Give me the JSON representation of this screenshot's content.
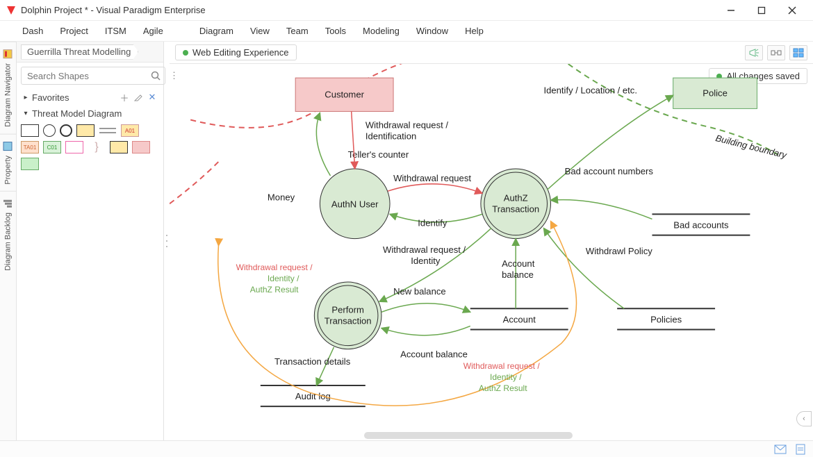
{
  "window": {
    "title": "Dolphin Project * - Visual Paradigm Enterprise"
  },
  "menu": {
    "items": [
      "Dash",
      "Project",
      "ITSM",
      "Agile",
      "Diagram",
      "View",
      "Team",
      "Tools",
      "Modeling",
      "Window",
      "Help"
    ]
  },
  "side_tabs": [
    "Diagram Navigator",
    "Property",
    "Diagram Backlog"
  ],
  "breadcrumb": {
    "item": "Guerrilla Threat Modelling"
  },
  "search": {
    "placeholder": "Search Shapes"
  },
  "favorites": {
    "label": "Favorites"
  },
  "section": {
    "label": "Threat Model Diagram"
  },
  "palette_labels": {
    "a01": "A01",
    "ta01": "TA01",
    "c01": "C01"
  },
  "doc": {
    "tab": "Web Editing Experience",
    "save_state": "All changes saved"
  },
  "diagram": {
    "customer": "Customer",
    "police": "Police",
    "authn": "AuthN User",
    "authz_l1": "AuthZ",
    "authz_l2": "Transaction",
    "perform_l1": "Perform",
    "perform_l2": "Transaction",
    "building_boundary": "Building boundary",
    "labels": {
      "identify_loc": "Identify / Location / etc.",
      "withdraw_req_id_l1": "Withdrawal request /",
      "withdraw_req_id_l2": "Identification",
      "tellers_counter": "Teller's counter",
      "withdrawal_request": "Withdrawal request",
      "identify": "Identify",
      "money": "Money",
      "bad_account_numbers": "Bad account numbers",
      "bad_accounts": "Bad accounts",
      "withdraw_policy": "Withdrawl Policy",
      "policies": "Policies",
      "withdraw_req_identity_l1": "Withdrawal request /",
      "withdraw_req_identity_l2": "Identity",
      "red_wr_l1": "Withdrawal request /",
      "red_wr_l2": "Identity /",
      "red_wr_l3": "AuthZ Result",
      "red2_wr_l1": "Withdrawal request /",
      "red2_wr_l2": "Identity /",
      "red2_wr_l3": "AuthZ Result",
      "account_balance": "Account balance",
      "account_balance2": "Account balance",
      "account_balance2_l1": "Account",
      "account_balance2_l2": "balance",
      "new_balance": "New balance",
      "account": "Account",
      "transaction_details": "Transaction details",
      "audit_log": "Audit log"
    }
  }
}
